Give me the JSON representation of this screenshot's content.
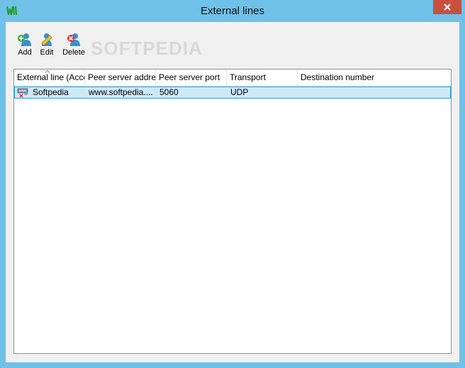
{
  "window": {
    "title": "External lines",
    "colors": {
      "frame": "#6fc1e8",
      "close": "#c7503e",
      "selection": "#cde8f7"
    }
  },
  "toolbar": {
    "add_label": "Add",
    "edit_label": "Edit",
    "delete_label": "Delete",
    "watermark": "SOFTPEDIA"
  },
  "table": {
    "columns": [
      "External line (Acco",
      "Peer server addres",
      "Peer server port",
      "Transport",
      "Destination number"
    ],
    "rows": [
      {
        "name": "Softpedia",
        "address": "www.softpedia....",
        "port": "5060",
        "transport": "UDP",
        "destination": ""
      }
    ]
  }
}
